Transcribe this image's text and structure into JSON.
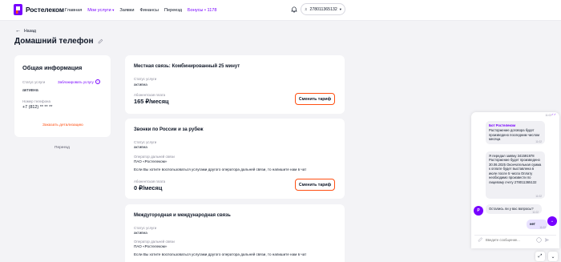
{
  "header": {
    "logo_text": "Ростелеком",
    "nav": [
      {
        "label": "Главная"
      },
      {
        "label": "Мои услуги"
      },
      {
        "label": "Заявки"
      },
      {
        "label": "Финансы"
      },
      {
        "label": "Переезд"
      },
      {
        "label": "Бонусы • 1178"
      }
    ],
    "account_number": "278011365132"
  },
  "back_label": "Назад",
  "page_title": "Домашний телефон",
  "general": {
    "title": "Общая информация",
    "status_label": "Статус услуги",
    "block_link": "Заблокировать услугу",
    "status_value": "активна",
    "phone_label": "Номер телефона",
    "phone_value": "+7 (812) ** ** **",
    "detail_link": "Заказать детализацию",
    "move_link": "Переезд"
  },
  "services": [
    {
      "title": "Местная связь: Комбинированный 25 минут",
      "status_label": "Статус услуги",
      "status_value": "активна",
      "fee_label": "Абонентская плата",
      "fee_value": "165 ₽/месяц",
      "button": "Сменить тариф"
    },
    {
      "title": "Звонки по России и за рубеж",
      "status_label": "Статус услуги",
      "status_value": "активна",
      "operator_label": "Оператор дальней связи",
      "operator_value": "ПАО «Ростелеком»",
      "note": "Если Вы хотите воспользоваться услугами другого оператора дальней связи, то напишите нам в чат",
      "fee_label": "Абонентская плата",
      "fee_value": "0 ₽/месяц",
      "button": "Сменить тариф"
    },
    {
      "title": "Междугородная и международная связь",
      "status_label": "Статус услуги",
      "status_value": "активна",
      "operator_label": "Оператор дальней связи",
      "operator_value": "ПАО «Ростелеком»",
      "note": "Если Вы хотите воспользоваться услугами другого оператора дальней связи, то напишите нам в чат"
    }
  ],
  "chat": {
    "bot_name": "Бот Ростелеком",
    "msg1": "Расторжение договора будет произведено последним числом месяца",
    "msg1_time": "11:02",
    "msg2": "Я передал заявку 341591978 Расторжение будет произведено 30.06.2025 Окончательная сумма к оплате будет выставлена в июле после 5 числа Оплату необходимо произвести по лицевому счету 278011365132",
    "msg2_time": "11:02",
    "msg3": "Остались ли у вас вопросы?",
    "msg3_time": "11:02",
    "user_reply": "нет",
    "user_reply_time": "11:02",
    "top_time": "11:02",
    "input_placeholder": "Введите сообщение...",
    "bot_avatar_letter": "Р"
  },
  "colors": {
    "brand": "#7700ff",
    "accent": "#ff4f12"
  }
}
